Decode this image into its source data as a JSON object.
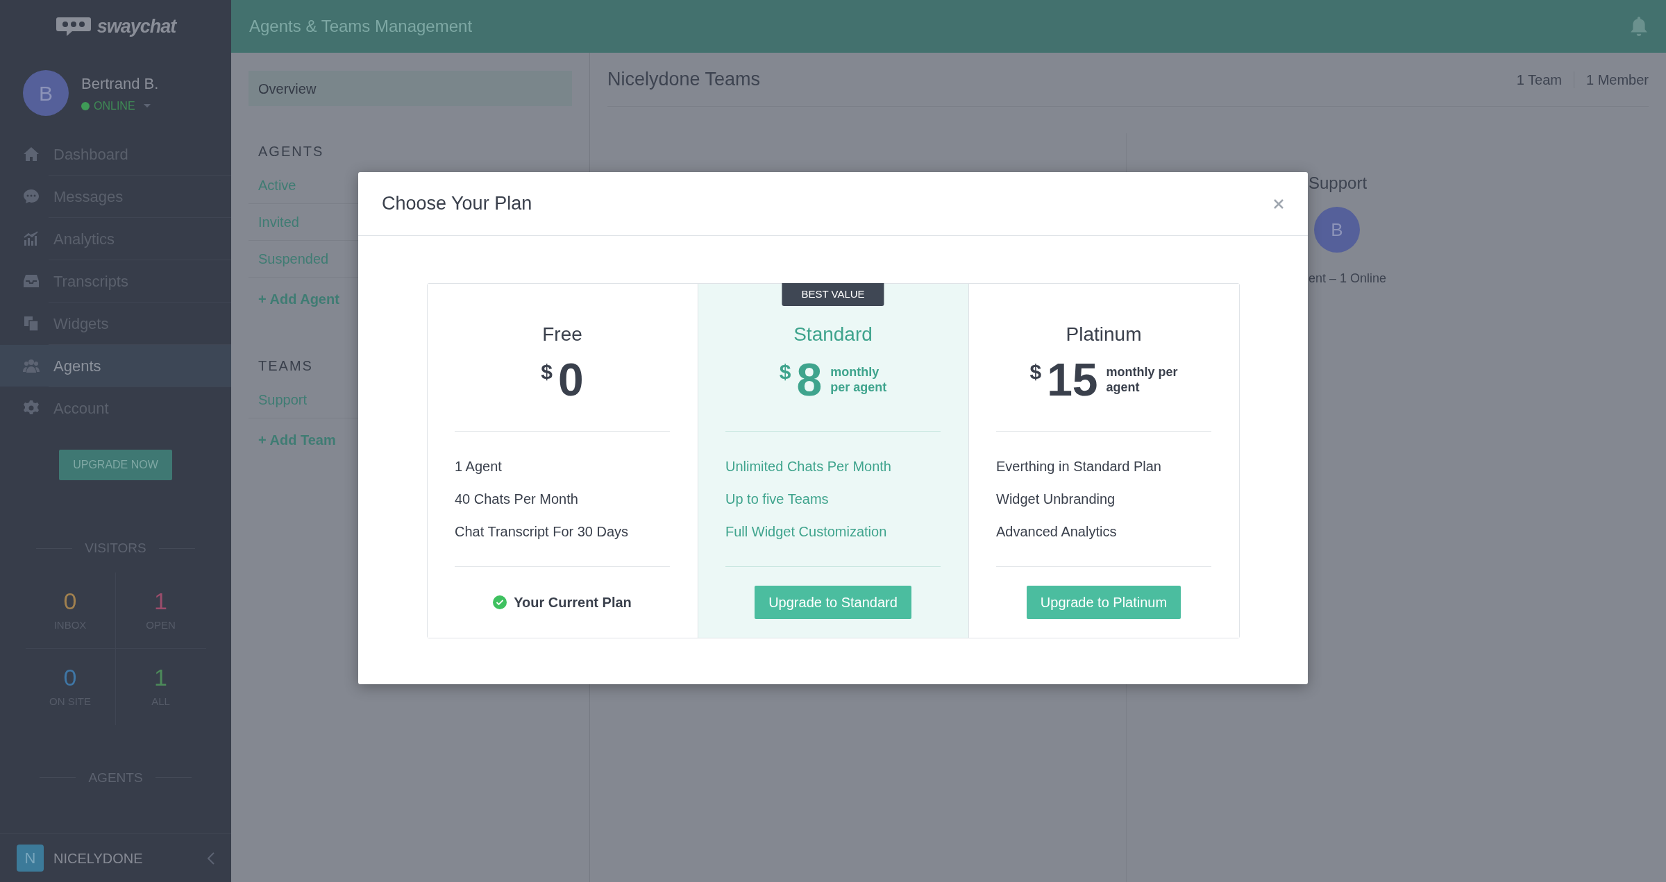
{
  "sidebar": {
    "logo": "swaychat",
    "user": {
      "initial": "B",
      "name": "Bertrand B.",
      "status": "ONLINE",
      "online": true
    },
    "nav": [
      {
        "label": "Dashboard",
        "selected": false
      },
      {
        "label": "Messages",
        "selected": false
      },
      {
        "label": "Analytics",
        "selected": false
      },
      {
        "label": "Transcripts",
        "selected": false
      },
      {
        "label": "Widgets",
        "selected": false
      },
      {
        "label": "Agents",
        "selected": true
      },
      {
        "label": "Account",
        "selected": false
      }
    ],
    "upgrade_button": "UPGRADE NOW",
    "visitors": {
      "title": "VISITORS",
      "stats": [
        {
          "value": "0",
          "label": "INBOX",
          "color": "#a0804f"
        },
        {
          "value": "1",
          "label": "OPEN",
          "color": "#9b4d6b"
        },
        {
          "value": "0",
          "label": "ON SITE",
          "color": "#3f76a5"
        },
        {
          "value": "1",
          "label": "ALL",
          "color": "#4c8a5a"
        }
      ]
    },
    "agents_title": "AGENTS",
    "workspace": {
      "initial": "N",
      "name": "NICELYDONE"
    }
  },
  "header": {
    "title": "Agents & Teams Management"
  },
  "subnav": {
    "overview": {
      "label": "Overview",
      "selected": true
    },
    "sections": [
      {
        "title": "AGENTS",
        "items": [
          {
            "label": "Active",
            "kind": "link"
          },
          {
            "label": "Invited",
            "kind": "link"
          },
          {
            "label": "Suspended",
            "kind": "link"
          },
          {
            "label": "+ Add Agent",
            "kind": "action"
          }
        ]
      },
      {
        "title": "TEAMS",
        "items": [
          {
            "label": "Support",
            "kind": "link"
          },
          {
            "label": "+ Add Team",
            "kind": "action"
          }
        ]
      }
    ]
  },
  "main": {
    "title": "Nicelydone Teams",
    "counts": [
      "1 Team",
      "1 Member"
    ],
    "team": {
      "name": "Support",
      "avatar": "B",
      "summary": "ent – 1 Online"
    }
  },
  "modal": {
    "title": "Choose Your Plan",
    "plans": [
      {
        "name": "Free",
        "currency": "$",
        "price": "0",
        "highlighted": false,
        "features": [
          "1 Agent",
          "40 Chats Per Month",
          "Chat Transcript For 30 Days"
        ],
        "footer": {
          "kind": "current",
          "label": "Your Current Plan"
        }
      },
      {
        "name": "Standard",
        "badge": "BEST VALUE",
        "currency": "$",
        "price": "8",
        "period": "monthly\nper agent",
        "highlighted": true,
        "features": [
          "Unlimited Chats Per Month",
          "Up to five Teams",
          "Full Widget Customization"
        ],
        "footer": {
          "kind": "upgrade",
          "label": "Upgrade to Standard"
        }
      },
      {
        "name": "Platinum",
        "currency": "$",
        "price": "15",
        "period": "monthly per\nagent",
        "highlighted": false,
        "features": [
          "Everthing in Standard Plan",
          "Widget Unbranding",
          "Advanced Analytics"
        ],
        "footer": {
          "kind": "upgrade",
          "label": "Upgrade to Platinum"
        }
      }
    ]
  }
}
